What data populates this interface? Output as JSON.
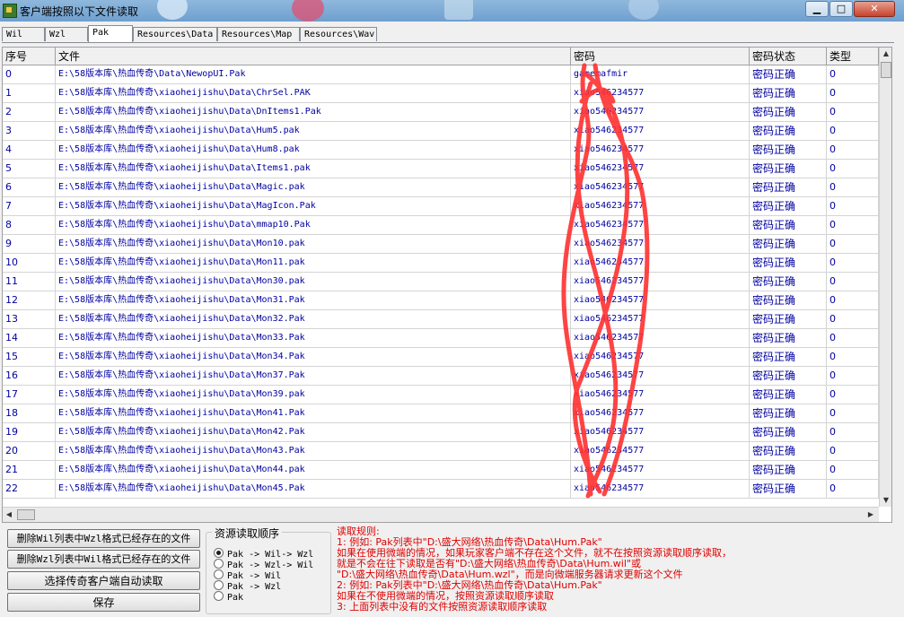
{
  "window": {
    "title": "客户端按照以下文件读取",
    "min_icon": "minimize-icon",
    "max_icon": "maximize-icon",
    "close_icon": "close-icon"
  },
  "tabs": [
    {
      "label": "Wil"
    },
    {
      "label": "Wzl"
    },
    {
      "label": "Pak"
    },
    {
      "label": "Resources\\Data"
    },
    {
      "label": "Resources\\Map"
    },
    {
      "label": "Resources\\Wav"
    }
  ],
  "active_tab": "Pak",
  "grid": {
    "columns": {
      "idx": "序号",
      "file": "文件",
      "pwd": "密码",
      "stat": "密码状态",
      "type": "类型"
    },
    "rows": [
      {
        "idx": "0",
        "file": "E:\\58版本库\\热血传奇\\Data\\NewopUI.Pak",
        "pwd": "gamemafmir",
        "stat": "密码正确",
        "type": "0"
      },
      {
        "idx": "1",
        "file": "E:\\58版本库\\热血传奇\\xiaoheijishu\\Data\\ChrSel.PAK",
        "pwd": "xiao546234577",
        "stat": "密码正确",
        "type": "0"
      },
      {
        "idx": "2",
        "file": "E:\\58版本库\\热血传奇\\xiaoheijishu\\Data\\DnItems1.Pak",
        "pwd": "xiao546234577",
        "stat": "密码正确",
        "type": "0"
      },
      {
        "idx": "3",
        "file": "E:\\58版本库\\热血传奇\\xiaoheijishu\\Data\\Hum5.pak",
        "pwd": "xiao546234577",
        "stat": "密码正确",
        "type": "0"
      },
      {
        "idx": "4",
        "file": "E:\\58版本库\\热血传奇\\xiaoheijishu\\Data\\Hum8.pak",
        "pwd": "xiao546234577",
        "stat": "密码正确",
        "type": "0"
      },
      {
        "idx": "5",
        "file": "E:\\58版本库\\热血传奇\\xiaoheijishu\\Data\\Items1.pak",
        "pwd": "xiao546234577",
        "stat": "密码正确",
        "type": "0"
      },
      {
        "idx": "6",
        "file": "E:\\58版本库\\热血传奇\\xiaoheijishu\\Data\\Magic.pak",
        "pwd": "xiao546234577",
        "stat": "密码正确",
        "type": "0"
      },
      {
        "idx": "7",
        "file": "E:\\58版本库\\热血传奇\\xiaoheijishu\\Data\\MagIcon.Pak",
        "pwd": "xiao546234577",
        "stat": "密码正确",
        "type": "0"
      },
      {
        "idx": "8",
        "file": "E:\\58版本库\\热血传奇\\xiaoheijishu\\Data\\mmap10.Pak",
        "pwd": "xiao546234577",
        "stat": "密码正确",
        "type": "0"
      },
      {
        "idx": "9",
        "file": "E:\\58版本库\\热血传奇\\xiaoheijishu\\Data\\Mon10.pak",
        "pwd": "xiao546234577",
        "stat": "密码正确",
        "type": "0"
      },
      {
        "idx": "10",
        "file": "E:\\58版本库\\热血传奇\\xiaoheijishu\\Data\\Mon11.pak",
        "pwd": "xiao546234577",
        "stat": "密码正确",
        "type": "0"
      },
      {
        "idx": "11",
        "file": "E:\\58版本库\\热血传奇\\xiaoheijishu\\Data\\Mon30.pak",
        "pwd": "xiao546234577",
        "stat": "密码正确",
        "type": "0"
      },
      {
        "idx": "12",
        "file": "E:\\58版本库\\热血传奇\\xiaoheijishu\\Data\\Mon31.Pak",
        "pwd": "xiao546234577",
        "stat": "密码正确",
        "type": "0"
      },
      {
        "idx": "13",
        "file": "E:\\58版本库\\热血传奇\\xiaoheijishu\\Data\\Mon32.Pak",
        "pwd": "xiao546234577",
        "stat": "密码正确",
        "type": "0"
      },
      {
        "idx": "14",
        "file": "E:\\58版本库\\热血传奇\\xiaoheijishu\\Data\\Mon33.Pak",
        "pwd": "xiao546234577",
        "stat": "密码正确",
        "type": "0"
      },
      {
        "idx": "15",
        "file": "E:\\58版本库\\热血传奇\\xiaoheijishu\\Data\\Mon34.Pak",
        "pwd": "xiao546234577",
        "stat": "密码正确",
        "type": "0"
      },
      {
        "idx": "16",
        "file": "E:\\58版本库\\热血传奇\\xiaoheijishu\\Data\\Mon37.Pak",
        "pwd": "xiao546234577",
        "stat": "密码正确",
        "type": "0"
      },
      {
        "idx": "17",
        "file": "E:\\58版本库\\热血传奇\\xiaoheijishu\\Data\\Mon39.pak",
        "pwd": "xiao546234577",
        "stat": "密码正确",
        "type": "0"
      },
      {
        "idx": "18",
        "file": "E:\\58版本库\\热血传奇\\xiaoheijishu\\Data\\Mon41.Pak",
        "pwd": "xiao546234577",
        "stat": "密码正确",
        "type": "0"
      },
      {
        "idx": "19",
        "file": "E:\\58版本库\\热血传奇\\xiaoheijishu\\Data\\Mon42.Pak",
        "pwd": "xiao546234577",
        "stat": "密码正确",
        "type": "0"
      },
      {
        "idx": "20",
        "file": "E:\\58版本库\\热血传奇\\xiaoheijishu\\Data\\Mon43.Pak",
        "pwd": "xiao546234577",
        "stat": "密码正确",
        "type": "0"
      },
      {
        "idx": "21",
        "file": "E:\\58版本库\\热血传奇\\xiaoheijishu\\Data\\Mon44.pak",
        "pwd": "xiao546234577",
        "stat": "密码正确",
        "type": "0"
      },
      {
        "idx": "22",
        "file": "E:\\58版本库\\热血传奇\\xiaoheijishu\\Data\\Mon45.Pak",
        "pwd": "xiao546234577",
        "stat": "密码正确",
        "type": "0"
      }
    ]
  },
  "buttons": {
    "del_wil": "删除Wil列表中Wzl格式已经存在的文件",
    "del_wzl": "删除Wzl列表中Wil格式已经存在的文件",
    "choose_client": "选择传奇客户端自动读取",
    "save": "保存"
  },
  "order_group": {
    "title": "资源读取顺序",
    "options": [
      {
        "label": "Pak -> Wil-> Wzl",
        "selected": true
      },
      {
        "label": "Pak -> Wzl-> Wil",
        "selected": false
      },
      {
        "label": "Pak -> Wil",
        "selected": false
      },
      {
        "label": "Pak -> Wzl",
        "selected": false
      },
      {
        "label": "Pak",
        "selected": false
      }
    ]
  },
  "rules": [
    "读取规则:",
    "1: 例如: Pak列表中\"D:\\盛大网络\\热血传奇\\Data\\Hum.Pak\"",
    "    如果在使用微端的情况，如果玩家客户端不存在这个文件，就不在按照资源读取顺序读取，",
    "    就是不会在往下读取是否有\"D:\\盛大网络\\热血传奇\\Data\\Hum.wil\"或",
    "    \"D:\\盛大网络\\热血传奇\\Data\\Hum.wzl\"，而是向微端服务器请求更新这个文件",
    "2: 例如: Pak列表中\"D:\\盛大网络\\热血传奇\\Data\\Hum.Pak\"",
    "    如果在不使用微端的情况，按照资源读取顺序读取",
    "3: 上面列表中没有的文件按照资源读取顺序读取"
  ],
  "colors": {
    "rules_text": "#e00000",
    "cell_text": "#0000a0",
    "scribble": "#ff3030"
  }
}
